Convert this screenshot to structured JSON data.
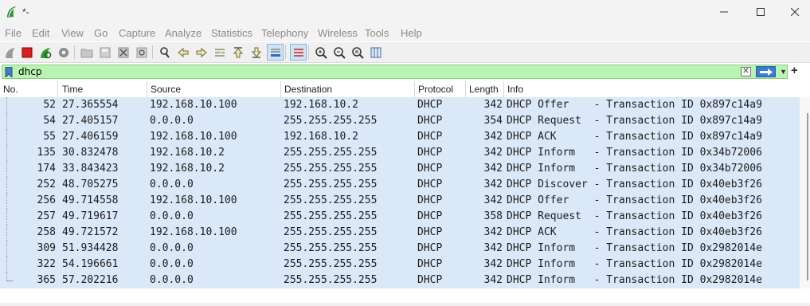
{
  "window": {
    "title": "*-"
  },
  "menu": [
    "File",
    "Edit",
    "View",
    "Go",
    "Capture",
    "Analyze",
    "Statistics",
    "Telephony",
    "Wireless",
    "Tools",
    "Help"
  ],
  "filter": {
    "value": "dhcp"
  },
  "columns": [
    "No.",
    "Time",
    "Source",
    "Destination",
    "Protocol",
    "Length",
    "Info"
  ],
  "packets": [
    {
      "no": "52",
      "time": "27.365554",
      "src": "192.168.10.100",
      "dst": "192.168.10.2",
      "proto": "DHCP",
      "len": "342",
      "info": "DHCP Offer    - Transaction ID 0x897c14a9"
    },
    {
      "no": "54",
      "time": "27.405157",
      "src": "0.0.0.0",
      "dst": "255.255.255.255",
      "proto": "DHCP",
      "len": "354",
      "info": "DHCP Request  - Transaction ID 0x897c14a9"
    },
    {
      "no": "55",
      "time": "27.406159",
      "src": "192.168.10.100",
      "dst": "192.168.10.2",
      "proto": "DHCP",
      "len": "342",
      "info": "DHCP ACK      - Transaction ID 0x897c14a9"
    },
    {
      "no": "135",
      "time": "30.832478",
      "src": "192.168.10.2",
      "dst": "255.255.255.255",
      "proto": "DHCP",
      "len": "342",
      "info": "DHCP Inform   - Transaction ID 0x34b72006"
    },
    {
      "no": "174",
      "time": "33.843423",
      "src": "192.168.10.2",
      "dst": "255.255.255.255",
      "proto": "DHCP",
      "len": "342",
      "info": "DHCP Inform   - Transaction ID 0x34b72006"
    },
    {
      "no": "252",
      "time": "48.705275",
      "src": "0.0.0.0",
      "dst": "255.255.255.255",
      "proto": "DHCP",
      "len": "342",
      "info": "DHCP Discover - Transaction ID 0x40eb3f26"
    },
    {
      "no": "256",
      "time": "49.714558",
      "src": "192.168.10.100",
      "dst": "255.255.255.255",
      "proto": "DHCP",
      "len": "342",
      "info": "DHCP Offer    - Transaction ID 0x40eb3f26"
    },
    {
      "no": "257",
      "time": "49.719617",
      "src": "0.0.0.0",
      "dst": "255.255.255.255",
      "proto": "DHCP",
      "len": "358",
      "info": "DHCP Request  - Transaction ID 0x40eb3f26"
    },
    {
      "no": "258",
      "time": "49.721572",
      "src": "192.168.10.100",
      "dst": "255.255.255.255",
      "proto": "DHCP",
      "len": "342",
      "info": "DHCP ACK      - Transaction ID 0x40eb3f26"
    },
    {
      "no": "309",
      "time": "51.934428",
      "src": "0.0.0.0",
      "dst": "255.255.255.255",
      "proto": "DHCP",
      "len": "342",
      "info": "DHCP Inform   - Transaction ID 0x2982014e"
    },
    {
      "no": "322",
      "time": "54.196661",
      "src": "0.0.0.0",
      "dst": "255.255.255.255",
      "proto": "DHCP",
      "len": "342",
      "info": "DHCP Inform   - Transaction ID 0x2982014e"
    },
    {
      "no": "365",
      "time": "57.202216",
      "src": "0.0.0.0",
      "dst": "255.255.255.255",
      "proto": "DHCP",
      "len": "342",
      "info": "DHCP Inform   - Transaction ID 0x2982014e"
    }
  ],
  "colors": {
    "row_bg": "#dbe8f8",
    "filter_valid_bg": "#b9f4b2",
    "apply_button": "#3b7bd1"
  }
}
